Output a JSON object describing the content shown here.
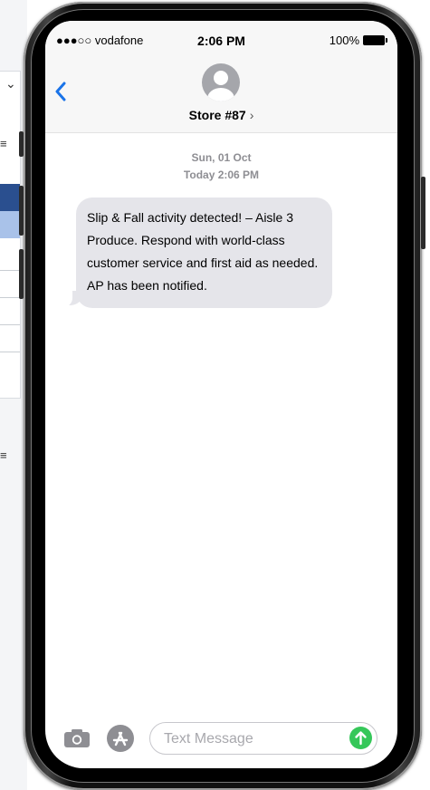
{
  "status_bar": {
    "carrier": "●●●○○ vodafone",
    "time": "2:06 PM",
    "battery": "100%"
  },
  "nav": {
    "back_icon": "chevron-left-icon",
    "contact_name": "Store #87",
    "contact_chevron": "›"
  },
  "thread": {
    "date_line": "Sun, 01 Oct",
    "time_line": "Today 2:06 PM",
    "messages": [
      {
        "direction": "incoming",
        "text": "Slip & Fall activity detected! – Aisle 3 Produce. Respond with world-class customer service and first aid as needed. AP has been notified."
      }
    ]
  },
  "composer": {
    "placeholder": "Text Message",
    "camera_icon": "camera-icon",
    "apps_icon": "app-store-icon",
    "send_icon": "send-arrow-icon"
  },
  "colors": {
    "accent": "#1a73e8",
    "bubble": "#e5e5ea",
    "send": "#35c759"
  }
}
